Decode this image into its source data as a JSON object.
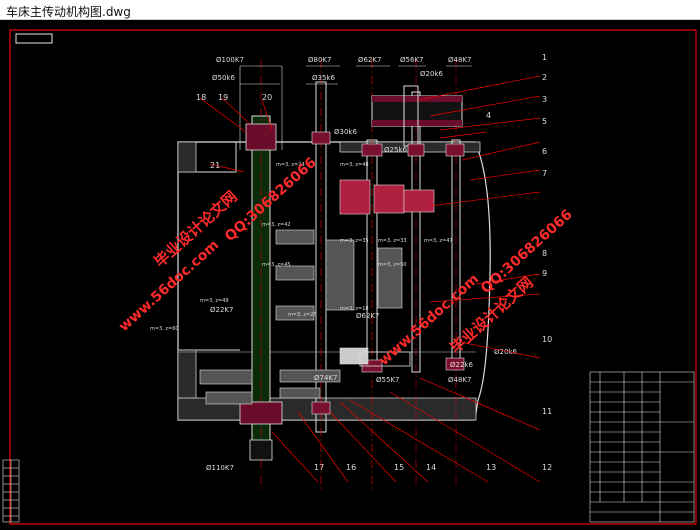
{
  "window": {
    "title": "车床主传动机构图.dwg"
  },
  "drawing": {
    "dimensions_top": [
      "Ø100K7",
      "Ø50k6",
      "Ø80K7",
      "Ø35k6",
      "Ø62K7",
      "Ø56K7",
      "Ø20k6",
      "Ø48K7",
      "Ø30k6",
      "Ø25k6"
    ],
    "dimensions_bottom": [
      "Ø22K7",
      "Ø62K7",
      "Ø20k6",
      "Ø22k6",
      "Ø48K7",
      "Ø55K7",
      "Ø74K7",
      "Ø110K7"
    ],
    "part_numbers": [
      "1",
      "2",
      "3",
      "4",
      "5",
      "6",
      "7",
      "8",
      "9",
      "10",
      "11",
      "12",
      "13",
      "14",
      "15",
      "16",
      "17",
      "18",
      "19",
      "20",
      "21"
    ],
    "gear_labels": [
      "m=3, z=48",
      "m=3, z=24",
      "m=3, z=42",
      "m=3, z=33",
      "m=3, z=47",
      "m=3, z=49",
      "m=3, z=35",
      "m=3, z=45",
      "m=3, z=26",
      "m=3, z=18",
      "m=3, z=60",
      "m=3, z=50"
    ],
    "watermarks": [
      "毕业设计论文网",
      "www.56doc.com",
      "QQ:306826066"
    ]
  }
}
